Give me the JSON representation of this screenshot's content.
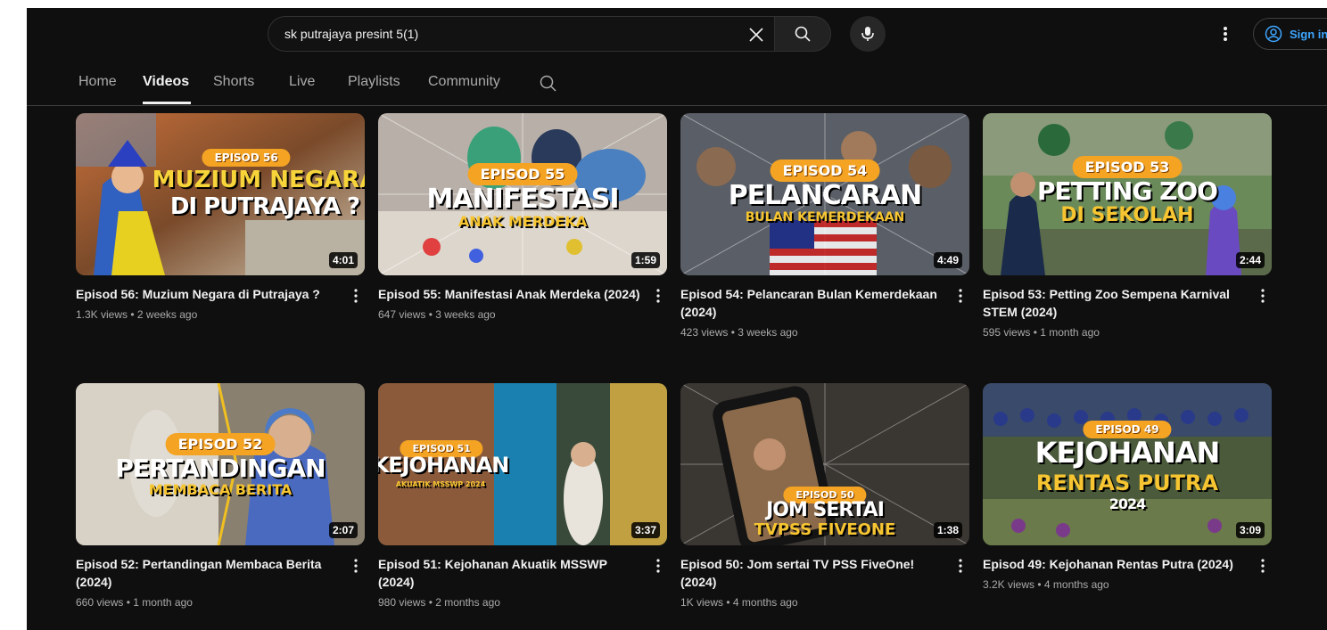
{
  "header": {
    "search_value": "sk putrajaya presint 5(1)",
    "signin_label": "Sign in"
  },
  "tabs": [
    {
      "label": "Home"
    },
    {
      "label": "Videos"
    },
    {
      "label": "Shorts"
    },
    {
      "label": "Live"
    },
    {
      "label": "Playlists"
    },
    {
      "label": "Community"
    }
  ],
  "videos": [
    {
      "title": "Episod 56: Muzium Negara di Putrajaya ?",
      "stats": "1.3K views • 2 weeks ago",
      "duration": "4:01",
      "thumb": {
        "episode": "EPISOD 56",
        "line1": "MUZIUM NEGARA",
        "line2": "DI PUTRAJAYA ?"
      }
    },
    {
      "title": "Episod 55: Manifestasi Anak Merdeka (2024)",
      "stats": "647 views • 3 weeks ago",
      "duration": "1:59",
      "thumb": {
        "episode": "EPISOD 55",
        "line1": "MANIFESTASI",
        "line2": "ANAK MERDEKA"
      }
    },
    {
      "title": "Episod 54: Pelancaran Bulan Kemerdekaan (2024)",
      "stats": "423 views • 3 weeks ago",
      "duration": "4:49",
      "thumb": {
        "episode": "EPISOD 54",
        "line1": "PELANCARAN",
        "line2": "BULAN KEMERDEKAAN"
      }
    },
    {
      "title": "Episod 53: Petting Zoo Sempena Karnival STEM (2024)",
      "stats": "595 views • 1 month ago",
      "duration": "2:44",
      "thumb": {
        "episode": "EPISOD 53",
        "line1": "PETTING ZOO",
        "line2": "DI SEKOLAH"
      }
    },
    {
      "title": "Episod 52: Pertandingan Membaca Berita (2024)",
      "stats": "660 views • 1 month ago",
      "duration": "2:07",
      "thumb": {
        "episode": "EPISOD 52",
        "line1": "PERTANDINGAN",
        "line2": "MEMBACA BERITA"
      }
    },
    {
      "title": "Episod 51: Kejohanan Akuatik MSSWP (2024)",
      "stats": "980 views • 2 months ago",
      "duration": "3:37",
      "thumb": {
        "episode": "EPISOD 51",
        "line1": "KEJOHANAN",
        "line2": "AKUATIK MSSWP 2024"
      }
    },
    {
      "title": "Episod 50: Jom sertai TV PSS FiveOne! (2024)",
      "stats": "1K views • 4 months ago",
      "duration": "1:38",
      "thumb": {
        "episode": "EPISOD 50",
        "line1": "JOM SERTAI",
        "line2": "TVPSS FIVEONE"
      }
    },
    {
      "title": "Episod 49: Kejohanan Rentas Putra (2024)",
      "stats": "3.2K views • 4 months ago",
      "duration": "3:09",
      "thumb": {
        "episode": "EPISOD 49",
        "line1": "KEJOHANAN",
        "line2": "RENTAS PUTRA",
        "line3": "2024"
      }
    }
  ],
  "colors": {
    "accent_orange": "#f4a322",
    "link_blue": "#3ea6ff",
    "background": "#0f0f0f"
  }
}
